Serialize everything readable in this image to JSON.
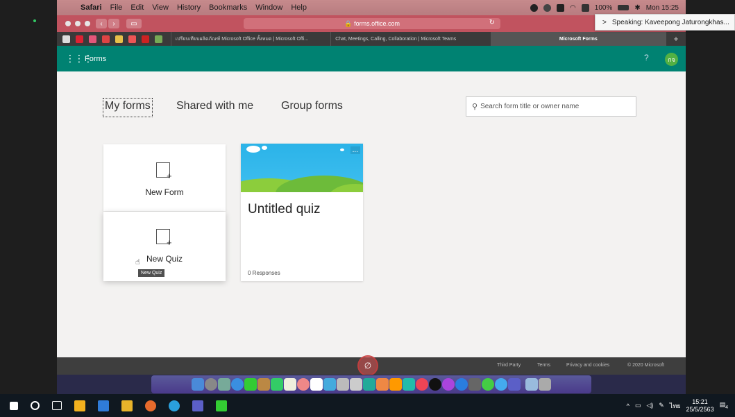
{
  "menubar": {
    "app": "Safari",
    "items": [
      "File",
      "Edit",
      "View",
      "History",
      "Bookmarks",
      "Window",
      "Help"
    ],
    "battery": "100%",
    "time": "Mon 15:25"
  },
  "safari": {
    "url": "forms.office.com",
    "tabs": [
      "เปรียบเทียบผลิตภัณฑ์ Microsoft Office ทั้งหมด | Microsoft Offi...",
      "Chat, Meetings, Calling, Collaboration | Microsoft Teams",
      "Microsoft Forms"
    ],
    "new_tab": "+"
  },
  "speaking": {
    "text": "Speaking: Kaveepong Jaturongkhas..."
  },
  "forms_header": {
    "waffle_icon": "waffle-icon",
    "title": "Forms",
    "help": "?",
    "avatar": "กจ"
  },
  "main": {
    "tabs": [
      {
        "label": "My forms",
        "active": true
      },
      {
        "label": "Shared with me",
        "active": false
      },
      {
        "label": "Group forms",
        "active": false
      }
    ],
    "search_placeholder": "Search form title or owner name",
    "new_form_label": "New Form",
    "new_quiz_label": "New Quiz",
    "tooltip": "New Quiz",
    "quiz_card": {
      "title": "Untitled quiz",
      "responses": "0 Responses",
      "more": "..."
    }
  },
  "footer": {
    "items": [
      "Third Party",
      "Terms",
      "Privacy and cookies",
      "© 2020 Microsoft"
    ]
  },
  "taskbar": {
    "lang": "ไทย",
    "time": "15:21",
    "date": "25/5/2563",
    "notifications": "4"
  },
  "colors": {
    "forms_green": "#008272",
    "safari_toolbar": "#c1535f",
    "menubar": "#c68a8c"
  }
}
